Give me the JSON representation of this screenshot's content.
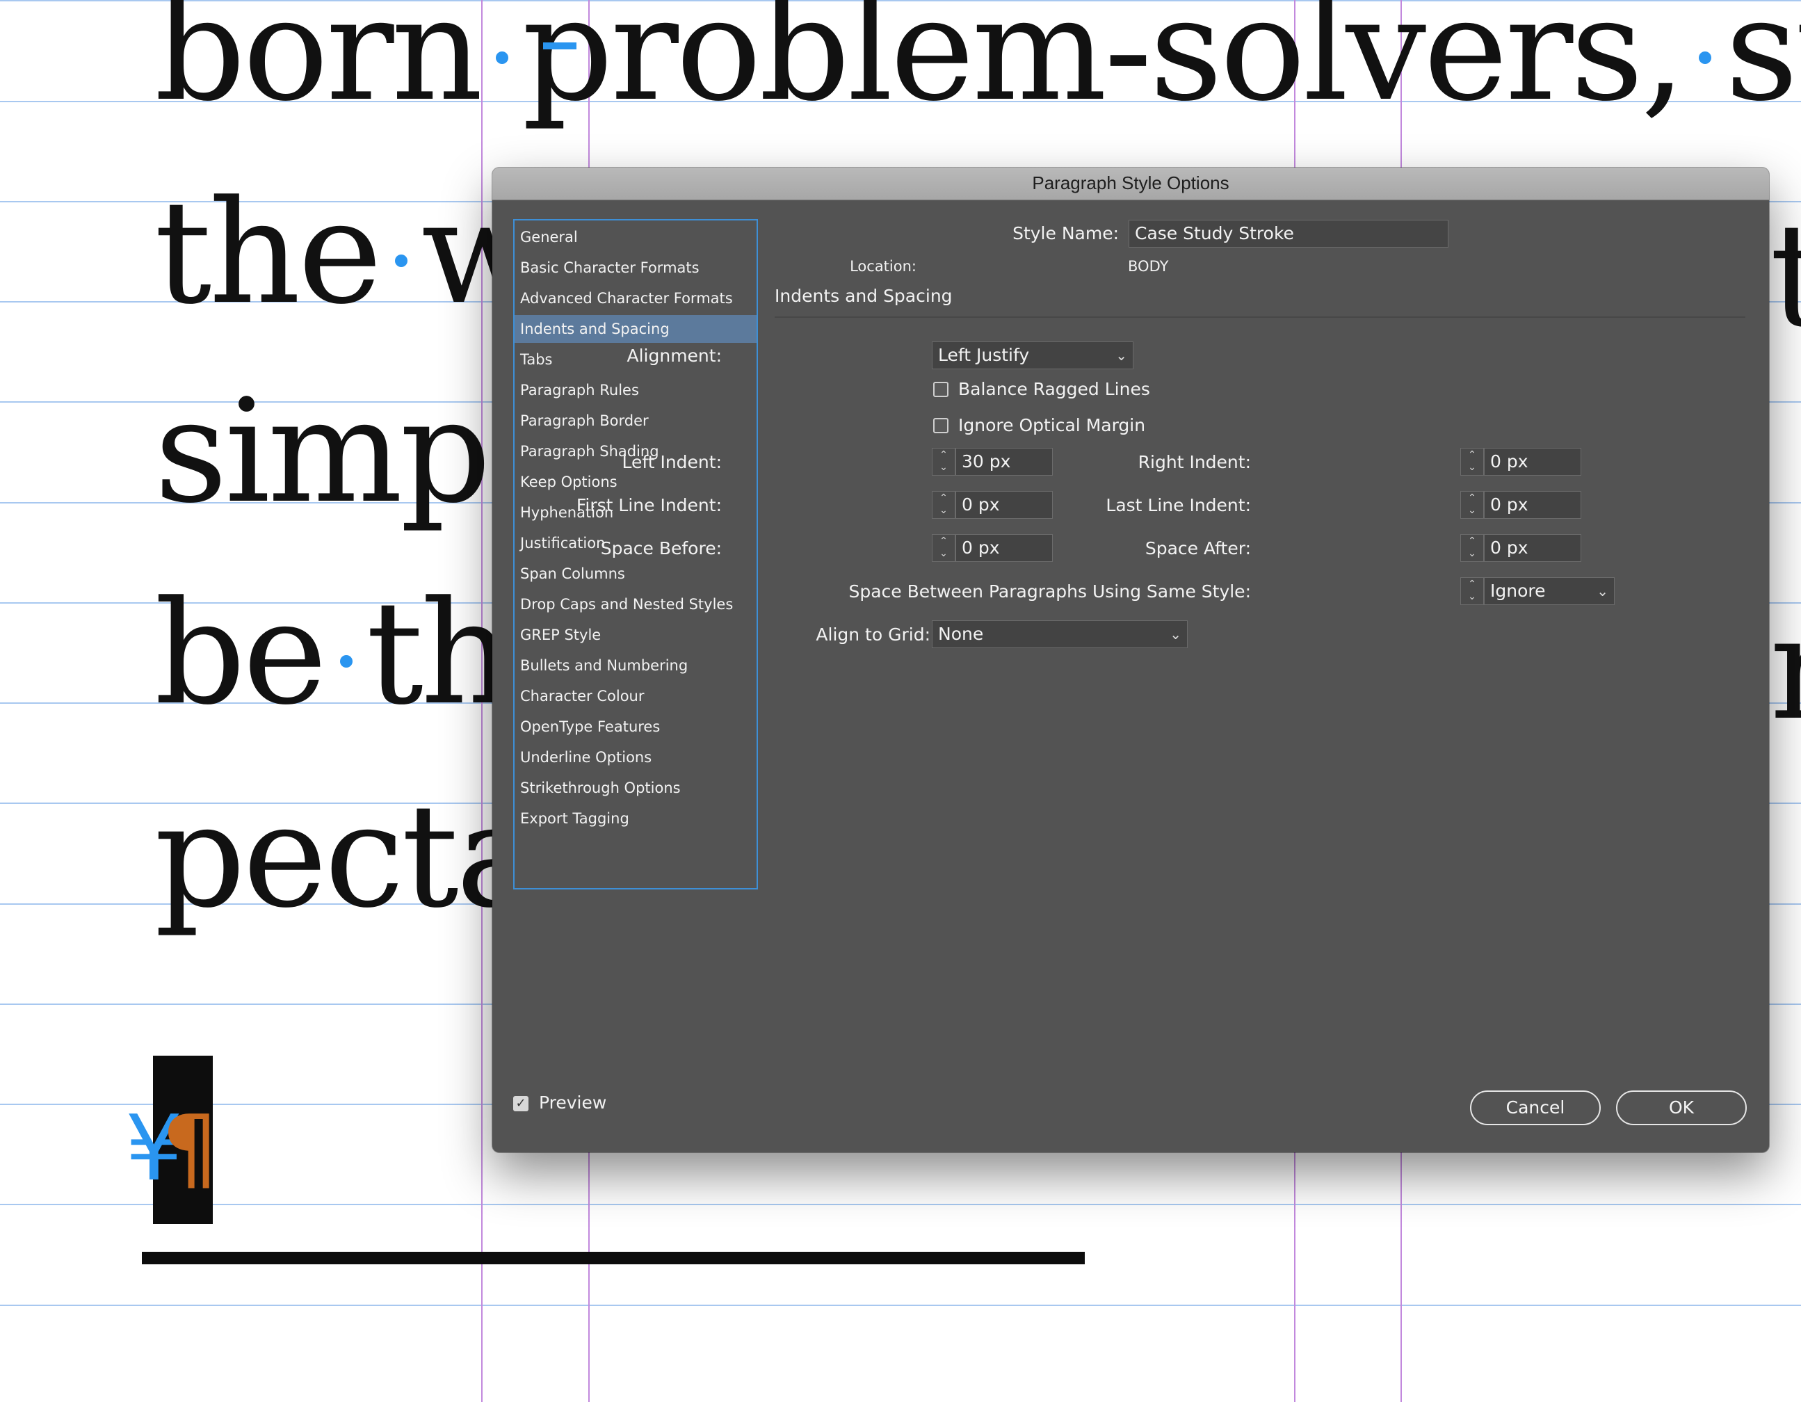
{
  "document": {
    "lines": [
      "born",
      "problem-solvers,",
      "stra",
      "the",
      "w",
      "simpl",
      "be",
      "the",
      "pectat"
    ],
    "fragments_right": [
      "t",
      "m"
    ]
  },
  "dialog": {
    "title": "Paragraph Style Options",
    "categories": [
      "General",
      "Basic Character Formats",
      "Advanced Character Formats",
      "Indents and Spacing",
      "Tabs",
      "Paragraph Rules",
      "Paragraph Border",
      "Paragraph Shading",
      "Keep Options",
      "Hyphenation",
      "Justification",
      "Span Columns",
      "Drop Caps and Nested Styles",
      "GREP Style",
      "Bullets and Numbering",
      "Character Colour",
      "OpenType Features",
      "Underline Options",
      "Strikethrough Options",
      "Export Tagging"
    ],
    "selected_category": "Indents and Spacing",
    "style_name_label": "Style Name:",
    "style_name_value": "Case Study Stroke",
    "location_label": "Location:",
    "location_value": "BODY",
    "section_title": "Indents and Spacing",
    "alignment": {
      "label": "Alignment:",
      "value": "Left Justify"
    },
    "balance_ragged": {
      "label": "Balance Ragged Lines",
      "checked": false
    },
    "ignore_optical": {
      "label": "Ignore Optical Margin",
      "checked": false
    },
    "left_indent": {
      "label": "Left Indent:",
      "value": "30 px"
    },
    "right_indent": {
      "label": "Right Indent:",
      "value": "0 px"
    },
    "first_line_indent": {
      "label": "First Line Indent:",
      "value": "0 px"
    },
    "last_line_indent": {
      "label": "Last Line Indent:",
      "value": "0 px"
    },
    "space_before": {
      "label": "Space Before:",
      "value": "0 px"
    },
    "space_after": {
      "label": "Space After:",
      "value": "0 px"
    },
    "space_between": {
      "label": "Space Between Paragraphs Using Same Style:",
      "value": "Ignore"
    },
    "align_to_grid": {
      "label": "Align to Grid:",
      "value": "None"
    },
    "preview": {
      "label": "Preview",
      "checked": true
    },
    "cancel_label": "Cancel",
    "ok_label": "OK"
  },
  "colors": {
    "dialog_bg": "#535353",
    "selection": "#5c7a9c",
    "list_border": "#3e8fd6",
    "baseline_grid": "#a8c8f0",
    "column_guide": "#c289dd",
    "invisible_marker": "#2a95f0",
    "pilcrow": "#c8691e"
  }
}
